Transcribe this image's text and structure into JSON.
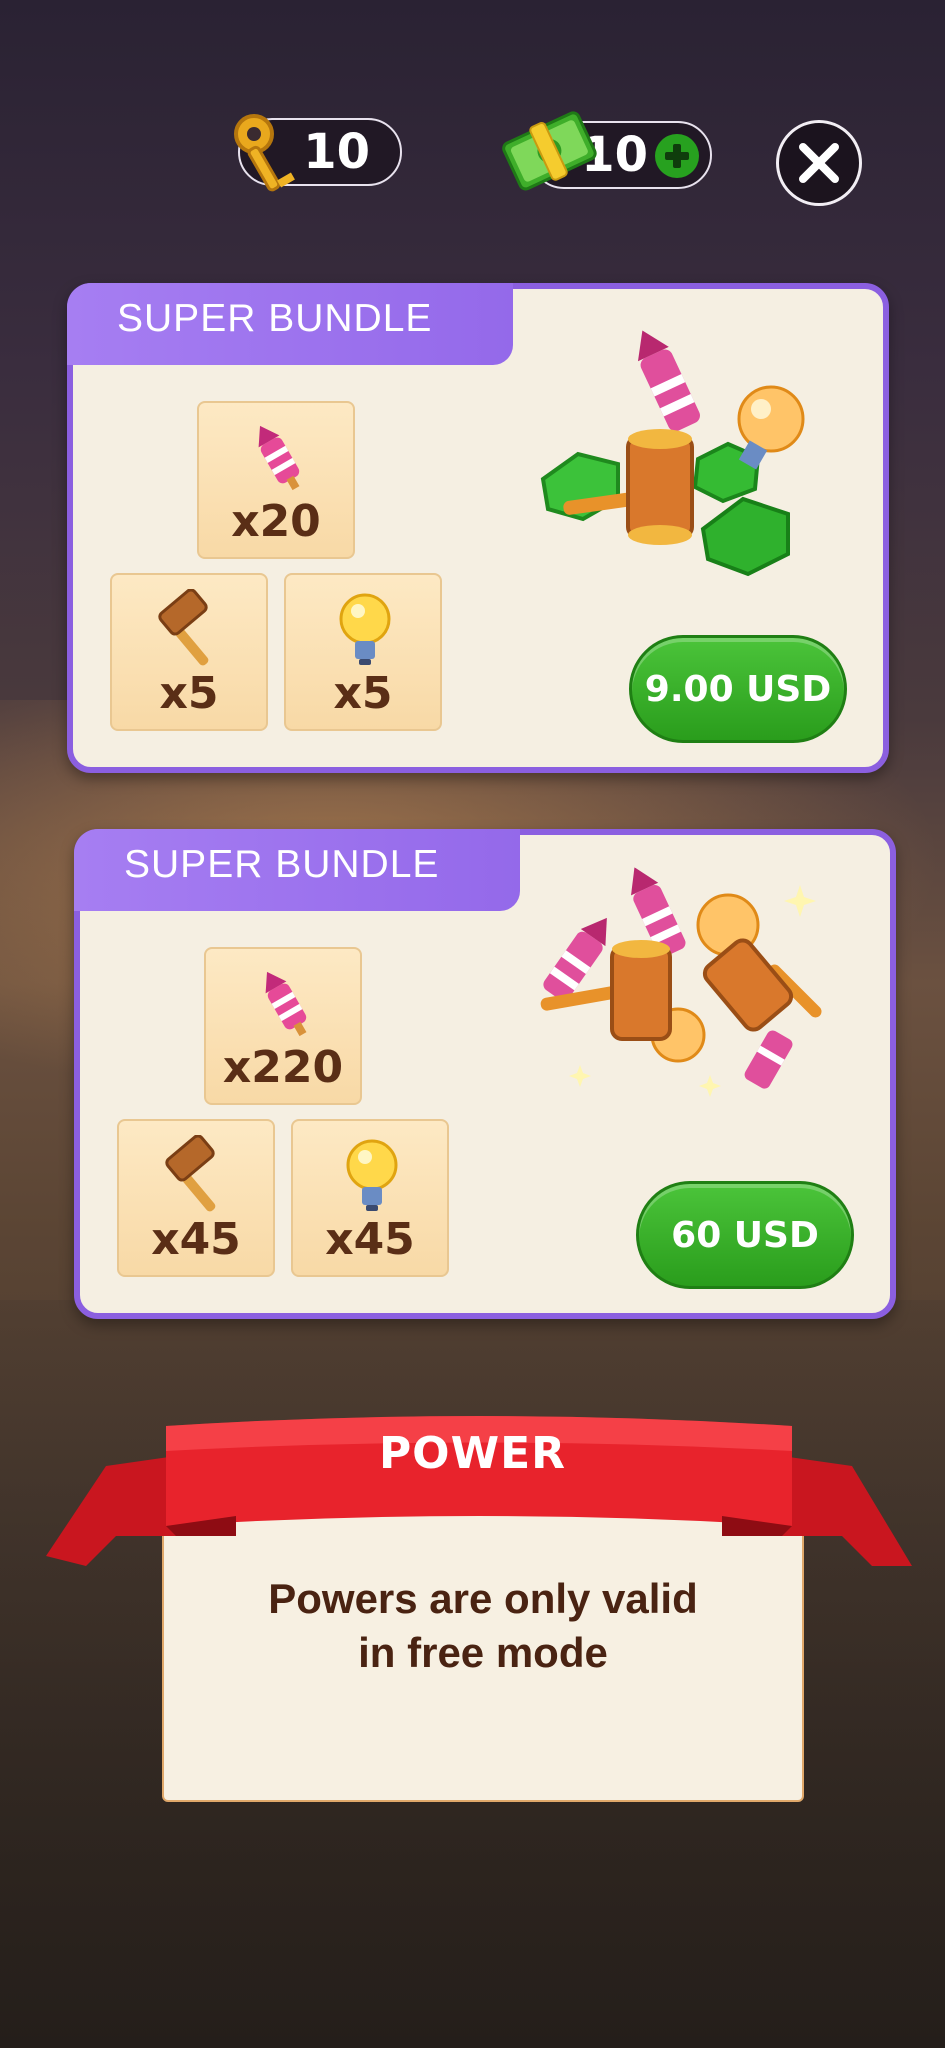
{
  "currency": {
    "keys": "10",
    "cash": "10"
  },
  "bundles": [
    {
      "title": "SUPER BUNDLE",
      "items": [
        {
          "icon": "rocket-icon",
          "qty": "x20"
        },
        {
          "icon": "hammer-icon",
          "qty": "x5"
        },
        {
          "icon": "lightbulb-icon",
          "qty": "x5"
        }
      ],
      "price": "9.00 USD"
    },
    {
      "title": "SUPER BUNDLE",
      "items": [
        {
          "icon": "rocket-icon",
          "qty": "x220"
        },
        {
          "icon": "hammer-icon",
          "qty": "x45"
        },
        {
          "icon": "lightbulb-icon",
          "qty": "x45"
        }
      ],
      "price": "60 USD"
    }
  ],
  "notice": {
    "title": "POWER",
    "line1": "Powers are only valid",
    "line2": "in free mode"
  },
  "colors": {
    "accent_purple": "#8b5fe0",
    "buy_green": "#2a9d1c",
    "ribbon_red": "#e0202a",
    "item_text": "#5a2e16"
  }
}
